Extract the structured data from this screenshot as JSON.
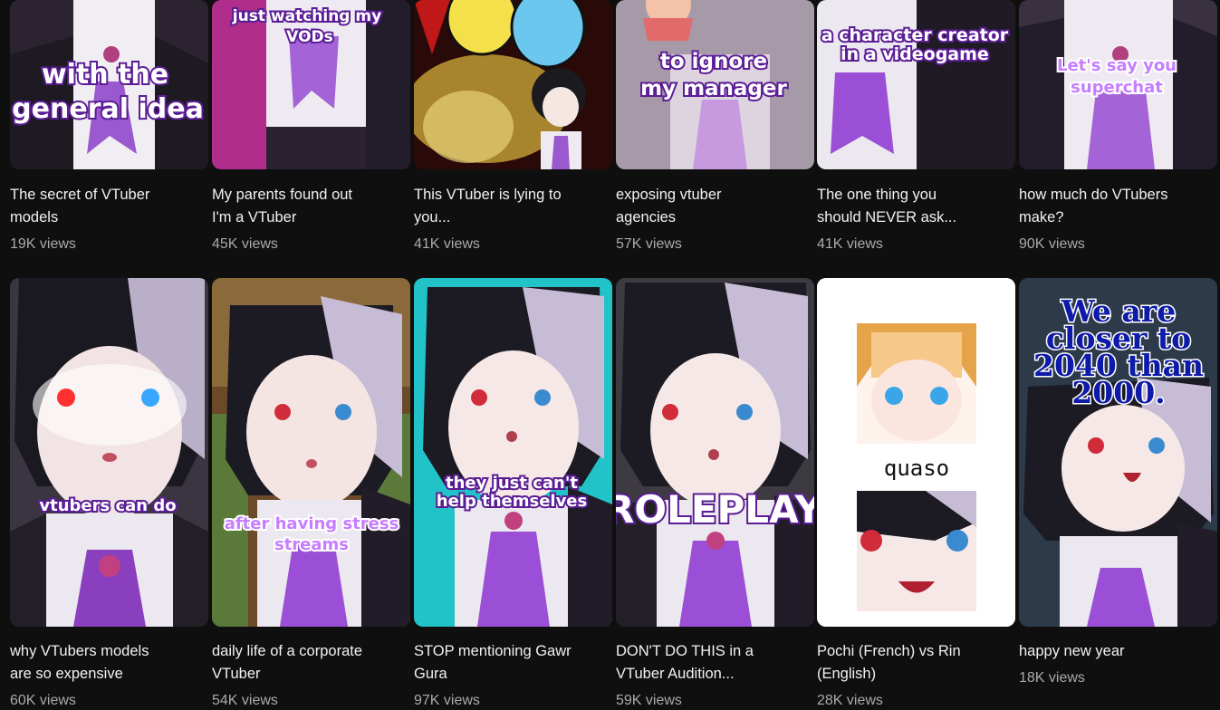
{
  "row1": [
    {
      "title_l1": "The secret of VTuber",
      "title_l2": "models",
      "views": "19K views",
      "caption": [
        "with the",
        "general idea"
      ]
    },
    {
      "title_l1": "My parents found out",
      "title_l2": "I'm a VTuber",
      "views": "45K views",
      "caption": [
        "just watching my",
        "VODs"
      ]
    },
    {
      "title_l1": "This VTuber is lying to",
      "title_l2": "you...",
      "views": "41K views",
      "caption": []
    },
    {
      "title_l1": "exposing vtuber",
      "title_l2": "agencies",
      "views": "57K views",
      "caption": [
        "to ignore",
        "my manager"
      ]
    },
    {
      "title_l1": "The one thing you",
      "title_l2": "should NEVER ask...",
      "views": "41K views",
      "caption": [
        "a character creator",
        "in a videogame"
      ]
    },
    {
      "title_l1": "how much do VTubers",
      "title_l2": "make?",
      "views": "90K views",
      "caption": [
        "Let's say you",
        "superchat"
      ]
    }
  ],
  "row2": [
    {
      "title_l1": "why VTubers models",
      "title_l2": "are so expensive",
      "views": "60K views",
      "caption": [
        "vtubers can do"
      ]
    },
    {
      "title_l1": "daily life of a corporate",
      "title_l2": "VTuber",
      "views": "54K views",
      "caption": [
        "after having stress",
        "streams"
      ]
    },
    {
      "title_l1": "STOP mentioning Gawr",
      "title_l2": "Gura",
      "views": "97K views",
      "caption": [
        "they just can't",
        "help themselves"
      ]
    },
    {
      "title_l1": "DON'T DO THIS in a",
      "title_l2": "VTuber Audition...",
      "views": "59K views",
      "caption": [
        "ROLEPLAY"
      ]
    },
    {
      "title_l1": "Pochi (French) vs Rin",
      "title_l2": "(English)",
      "views": "28K views",
      "caption": [
        "quaso"
      ]
    },
    {
      "title_l1": "happy new year",
      "title_l2": "",
      "views": "18K views",
      "caption": [
        "We are",
        "closer to",
        "2040 than",
        "2000."
      ]
    }
  ],
  "colors": {
    "background": "#0f0f0f",
    "text": "#f1f1f1",
    "meta": "#aaaaaa",
    "accent_purple": "#8e44c9"
  }
}
